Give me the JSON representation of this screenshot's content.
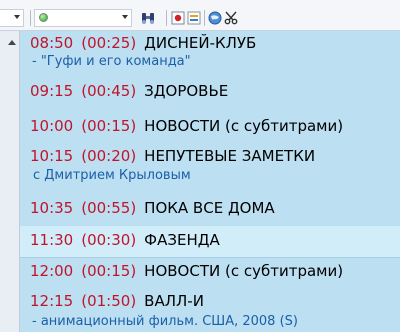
{
  "toolbar": {
    "combo_type": "",
    "combo_channel": "",
    "icons": [
      "binoculars-icon",
      "record-icon",
      "note-icon",
      "globe-icon",
      "scissors-icon"
    ]
  },
  "programs": [
    {
      "time": "08:50",
      "duration": "(00:25)",
      "title": "ДИСНЕЙ-КЛУБ",
      "subtitle": "- \"Гуфи и его команда\""
    },
    {
      "time": "09:15",
      "duration": "(00:45)",
      "title": "ЗДОРОВЬЕ",
      "subtitle": ""
    },
    {
      "time": "10:00",
      "duration": "(00:15)",
      "title": "НОВОСТИ (с субтитрами)",
      "subtitle": ""
    },
    {
      "time": "10:15",
      "duration": "(00:20)",
      "title": "НЕПУТЕВЫЕ ЗАМЕТКИ",
      "subtitle": "с Дмитрием Крыловым"
    },
    {
      "time": "10:35",
      "duration": "(00:55)",
      "title": "ПОКА ВСЕ ДОМА",
      "subtitle": ""
    },
    {
      "time": "11:30",
      "duration": "(00:30)",
      "title": "ФАЗЕНДА",
      "subtitle": ""
    },
    {
      "time": "12:00",
      "duration": "(00:15)",
      "title": "НОВОСТИ (с субтитрами)",
      "subtitle": ""
    },
    {
      "time": "12:15",
      "duration": "(01:50)",
      "title": "ВАЛЛ-И",
      "subtitle": "- анимационный фильм. США, 2008 (S)"
    }
  ],
  "colors": {
    "time": "#c0142a",
    "title": "#000000",
    "subtitle": "#1b5fa8",
    "list_bg": "#bcdff2",
    "selected_bg": "#d2edfa"
  }
}
